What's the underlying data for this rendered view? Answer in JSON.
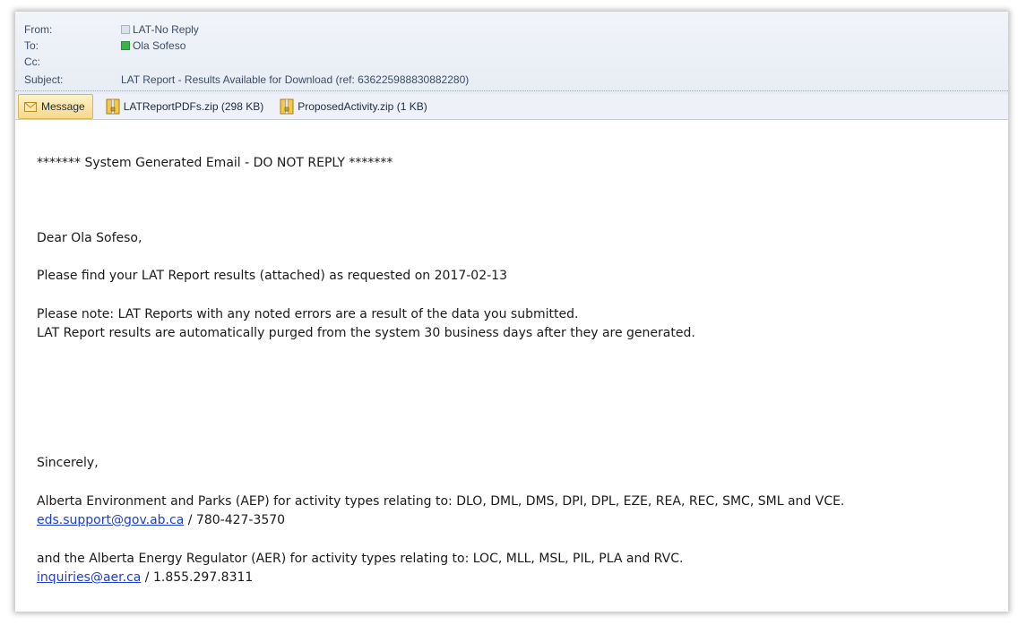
{
  "header": {
    "from_label": "From:",
    "from_value": "LAT-No Reply",
    "to_label": "To:",
    "to_value": "Ola Sofeso",
    "cc_label": "Cc:",
    "subject_label": "Subject:",
    "subject_value": "LAT Report - Results Available for Download  (ref: 636225988830882280)"
  },
  "attachments_bar": {
    "message_tab": "Message",
    "attachments": [
      {
        "name": "LATReportPDFs.zip (298 KB)",
        "icon": "zip-archive-icon"
      },
      {
        "name": "ProposedActivity.zip (1 KB)",
        "icon": "zip-archive-icon"
      }
    ]
  },
  "body": {
    "banner": "******* System Generated Email - DO NOT REPLY *******",
    "greeting": "Dear Ola Sofeso,",
    "p1": "Please find your LAT Report results (attached) as requested on 2017-02-13",
    "p2_l1": "Please note: LAT Reports with any noted errors are a result of the data you submitted.",
    "p2_l2": "LAT Report results are automatically purged from the system 30 business days after they are generated.",
    "closing": "Sincerely,",
    "aep_line": "Alberta Environment and Parks (AEP) for activity types relating to: DLO, DML, DMS, DPI, DPL, EZE, REA, REC, SMC, SML and VCE.",
    "aep_email": "eds.support@gov.ab.ca",
    "aep_phone": " / 780-427-3570",
    "aer_line": "and the Alberta Energy Regulator (AER) for activity types relating to: LOC, MLL, MSL, PIL, PLA and RVC.",
    "aer_email": "inquiries@aer.ca",
    "aer_phone": " / 1.855.297.8311"
  },
  "colors": {
    "header_bg": "#e9eef5",
    "link": "#1f3fcc",
    "message_tab": "#f6d98a"
  }
}
